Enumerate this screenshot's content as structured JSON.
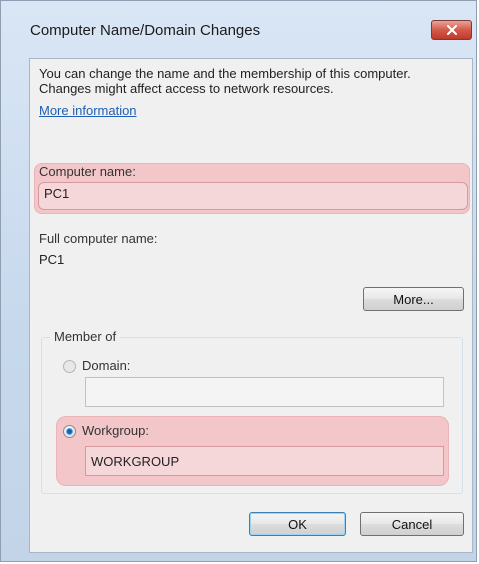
{
  "window": {
    "title": "Computer Name/Domain Changes",
    "close_icon": "close-icon"
  },
  "intro": {
    "description": "You can change the name and the membership of this computer. Changes might affect access to network resources.",
    "more_info_link": "More information"
  },
  "computer_name": {
    "label": "Computer name:",
    "value": "PC1"
  },
  "full_name": {
    "label": "Full computer name:",
    "value": "PC1"
  },
  "more_button": "More...",
  "member_of": {
    "title": "Member of",
    "domain": {
      "label": "Domain:",
      "value": "",
      "selected": false
    },
    "workgroup": {
      "label": "Workgroup:",
      "value": "WORKGROUP",
      "selected": true
    }
  },
  "footer": {
    "ok": "OK",
    "cancel": "Cancel"
  },
  "colors": {
    "highlight": "#f3c6c9",
    "link": "#1f5fb5",
    "close_button": "#c0392b"
  }
}
